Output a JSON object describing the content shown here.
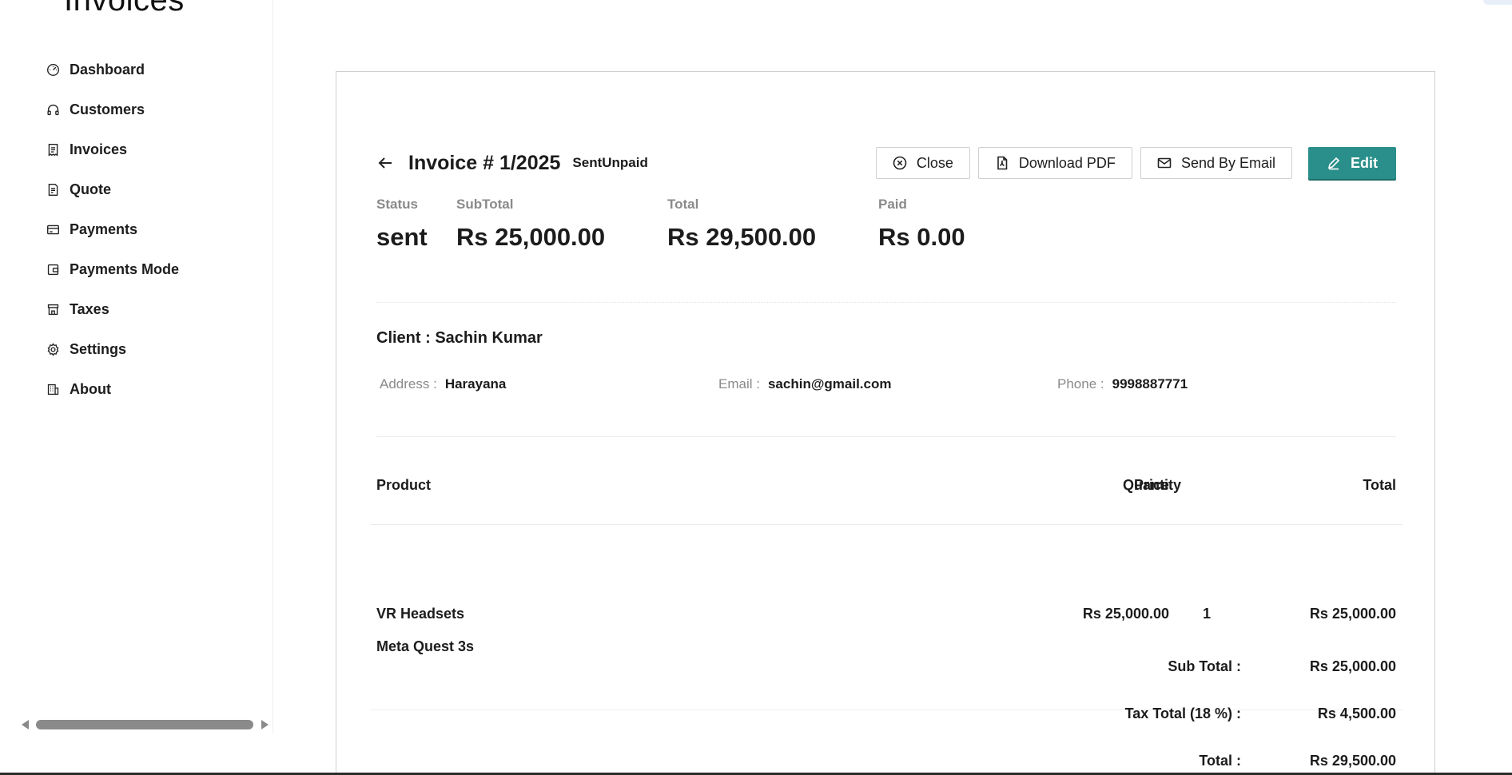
{
  "app": {
    "title": "Invoices"
  },
  "sidebar": {
    "items": [
      {
        "label": "Dashboard",
        "icon": "dashboard-icon"
      },
      {
        "label": "Customers",
        "icon": "headset-icon"
      },
      {
        "label": "Invoices",
        "icon": "invoice-icon"
      },
      {
        "label": "Quote",
        "icon": "quote-icon"
      },
      {
        "label": "Payments",
        "icon": "credit-card-icon"
      },
      {
        "label": "Payments Mode",
        "icon": "wallet-icon"
      },
      {
        "label": "Taxes",
        "icon": "shop-icon"
      },
      {
        "label": "Settings",
        "icon": "gear-icon"
      },
      {
        "label": "About",
        "icon": "building-icon"
      }
    ]
  },
  "invoice": {
    "title": "Invoice # 1/2025",
    "tags": "SentUnpaid",
    "actions": {
      "close_label": "Close",
      "download_label": "Download PDF",
      "email_label": "Send By Email",
      "edit_label": "Edit"
    },
    "stats": {
      "status_label": "Status",
      "status_value": "sent",
      "subtotal_label": "SubTotal",
      "subtotal_value": "Rs 25,000.00",
      "total_label": "Total",
      "total_value": "Rs 29,500.00",
      "paid_label": "Paid",
      "paid_value": "Rs 0.00"
    },
    "client": {
      "title": "Client : Sachin Kumar",
      "address_label": "Address :",
      "address_value": "Harayana",
      "email_label": "Email :",
      "email_value": "sachin@gmail.com",
      "phone_label": "Phone :",
      "phone_value": "9998887771"
    },
    "table": {
      "headers": {
        "product": "Product",
        "price": "Price",
        "quantity": "Quantity",
        "total": "Total"
      },
      "rows": [
        {
          "product": "VR Headsets",
          "description": "Meta Quest 3s",
          "price": "Rs 25,000.00",
          "quantity": "1",
          "total": "Rs 25,000.00"
        }
      ]
    },
    "totals": {
      "subtotal_label": "Sub Total :",
      "subtotal_value": "Rs 25,000.00",
      "tax_label": "Tax Total (18 %) :",
      "tax_value": "Rs 4,500.00",
      "total_label": "Total :",
      "total_value": "Rs 29,500.00"
    }
  },
  "colors": {
    "accent": "#2a8f8a",
    "muted_text": "#8a8a8a",
    "border": "#cfcfcf"
  }
}
